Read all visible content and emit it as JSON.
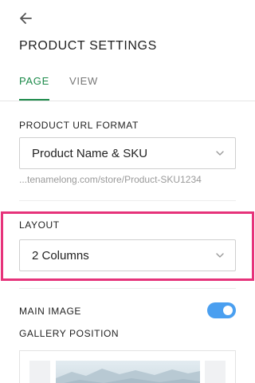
{
  "header": {
    "back_icon": "arrow-left-icon",
    "title": "PRODUCT SETTINGS"
  },
  "tabs": [
    {
      "label": "PAGE",
      "active": true
    },
    {
      "label": "VIEW",
      "active": false
    }
  ],
  "url_format": {
    "label": "PRODUCT URL FORMAT",
    "selected": "Product Name & SKU",
    "preview": "...tenamelong.com/store/Product-SKU1234"
  },
  "layout": {
    "label": "LAYOUT",
    "selected": "2 Columns"
  },
  "main_image": {
    "label": "MAIN IMAGE",
    "enabled": true
  },
  "gallery": {
    "label": "GALLERY POSITION"
  },
  "colors": {
    "accent_green": "#1c8a4a",
    "toggle_blue": "#4a9ff0",
    "highlight_pink": "#e6337a"
  }
}
